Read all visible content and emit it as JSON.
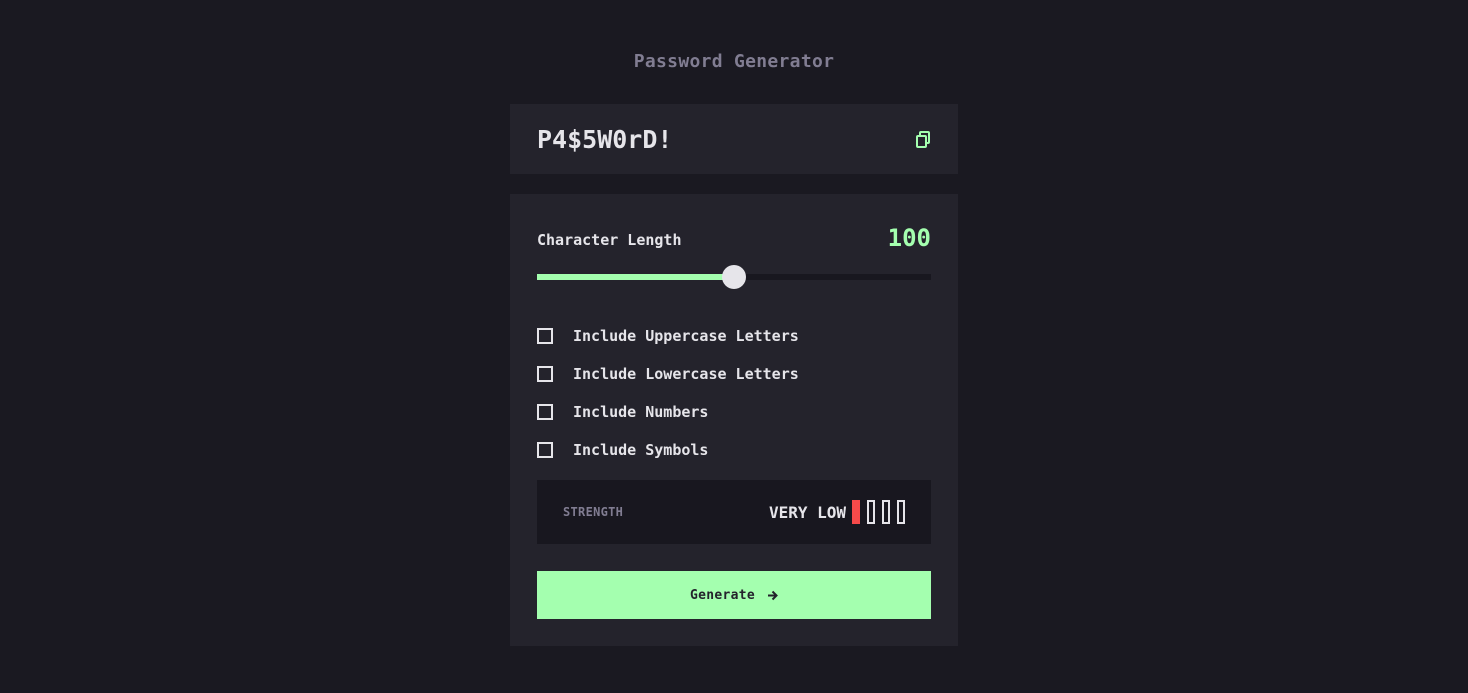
{
  "header": {
    "title": "Password Generator"
  },
  "output": {
    "password": "P4$5W0rD!",
    "copy_icon": "copy-icon"
  },
  "length": {
    "label": "Character Length",
    "value": "100",
    "slider_fraction": 0.5
  },
  "options": [
    {
      "label": "Include Uppercase Letters",
      "checked": false
    },
    {
      "label": "Include Lowercase Letters",
      "checked": false
    },
    {
      "label": "Include Numbers",
      "checked": false
    },
    {
      "label": "Include Symbols",
      "checked": false
    }
  ],
  "strength": {
    "label": "STRENGTH",
    "level": "VERY LOW",
    "filled_bars": 1,
    "total_bars": 4
  },
  "generate": {
    "label": "Generate",
    "icon": "arrow-right-icon"
  },
  "colors": {
    "background": "#1a1921",
    "panel": "#24232c",
    "accent": "#a4ffaf",
    "text": "#e6e5ea",
    "muted": "#817d92",
    "danger": "#f64a4a"
  }
}
